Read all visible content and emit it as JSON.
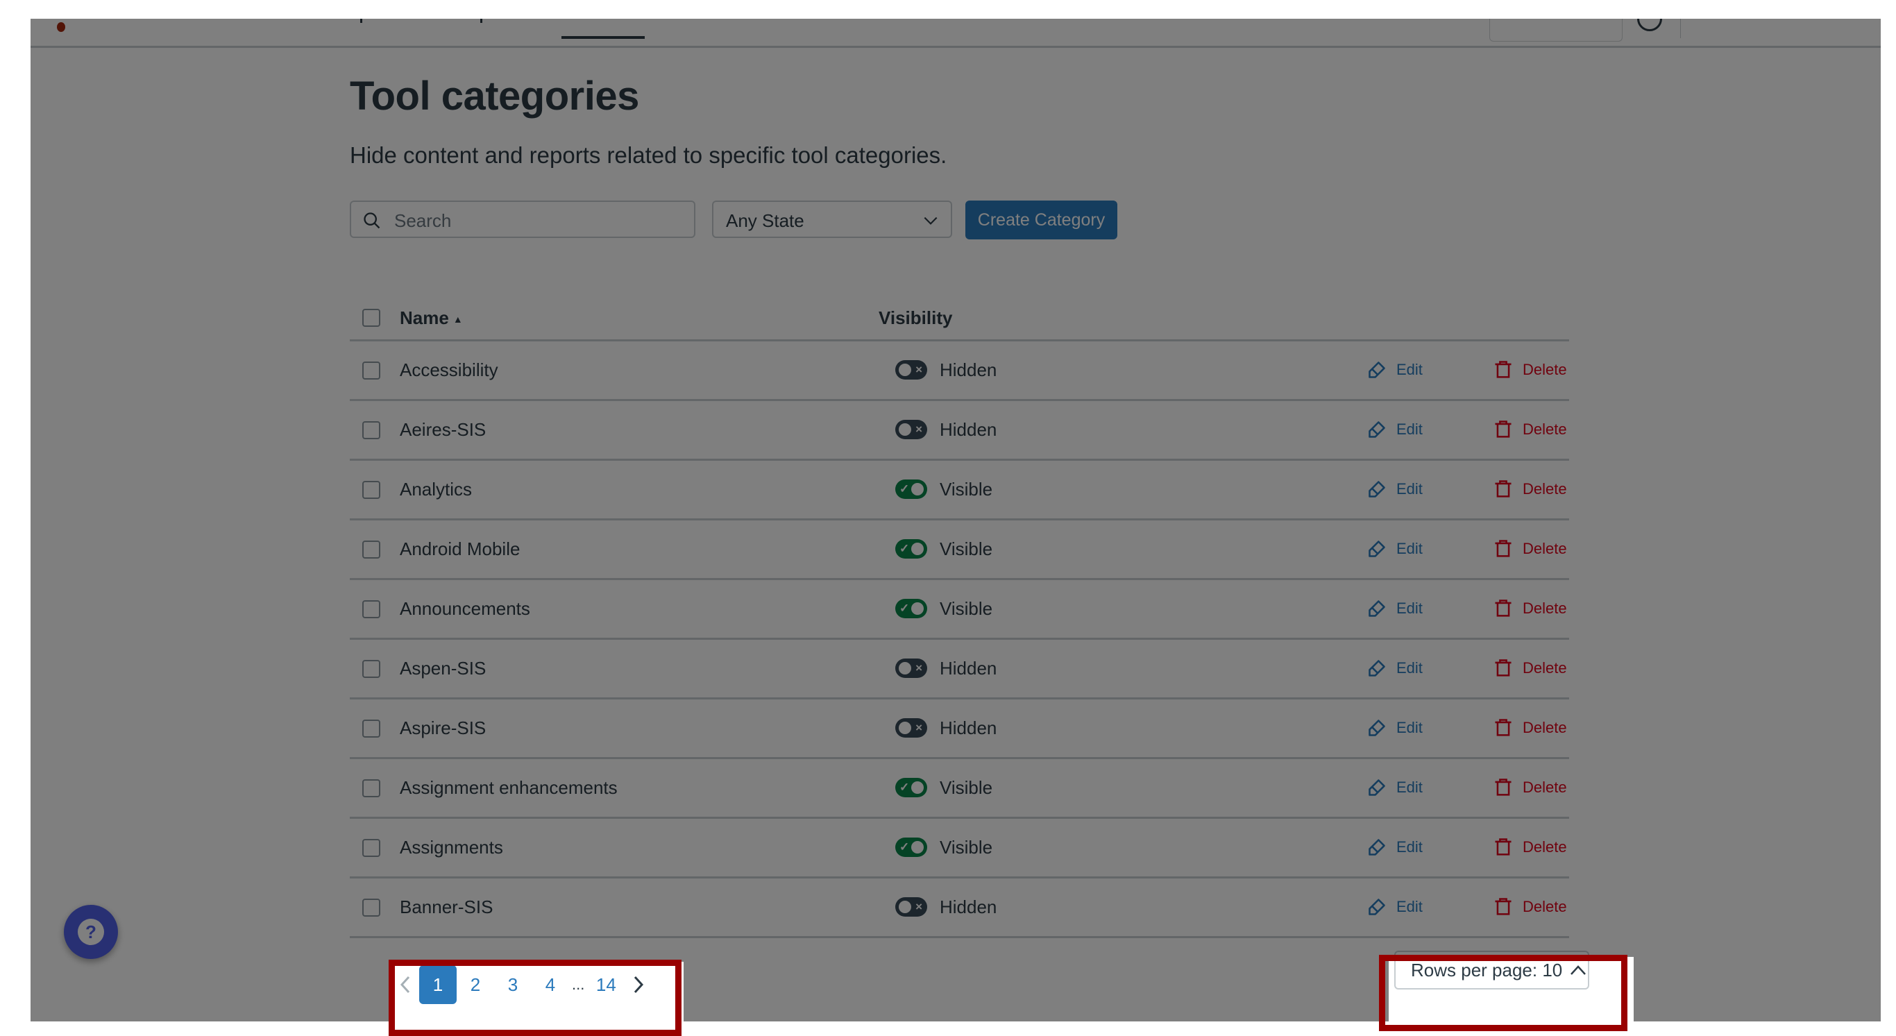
{
  "page": {
    "title": "Tool categories",
    "subtitle": "Hide content and reports related to specific tool categories."
  },
  "controls": {
    "search_placeholder": "Search",
    "search_value": "",
    "state_filter": "Any State",
    "create_button": "Create Category"
  },
  "table": {
    "columns": {
      "name": "Name",
      "sort_indicator": "▲",
      "visibility": "Visibility"
    },
    "edit_label": "Edit",
    "delete_label": "Delete",
    "rows": [
      {
        "name": "Accessibility",
        "visibility": "Hidden"
      },
      {
        "name": "Aeires-SIS",
        "visibility": "Hidden"
      },
      {
        "name": "Analytics",
        "visibility": "Visible"
      },
      {
        "name": "Android Mobile",
        "visibility": "Visible"
      },
      {
        "name": "Announcements",
        "visibility": "Visible"
      },
      {
        "name": "Aspen-SIS",
        "visibility": "Hidden"
      },
      {
        "name": "Aspire-SIS",
        "visibility": "Hidden"
      },
      {
        "name": "Assignment enhancements",
        "visibility": "Visible"
      },
      {
        "name": "Assignments",
        "visibility": "Visible"
      },
      {
        "name": "Banner-SIS",
        "visibility": "Hidden"
      }
    ]
  },
  "pagination": {
    "current_page": "1",
    "pages": [
      "1",
      "2",
      "3",
      "4"
    ],
    "ellipsis": "...",
    "last_page": "14",
    "rows_per_page_label": "Rows per page: 10"
  },
  "colors": {
    "primary": "#2b7abc",
    "danger": "#e0061f",
    "visible_toggle": "#0b874b",
    "hidden_toggle": "#394b58",
    "help_button": "#5060e6",
    "highlight_border": "#990000",
    "dim_overlay": "rgba(0,0,0,0.5)"
  }
}
